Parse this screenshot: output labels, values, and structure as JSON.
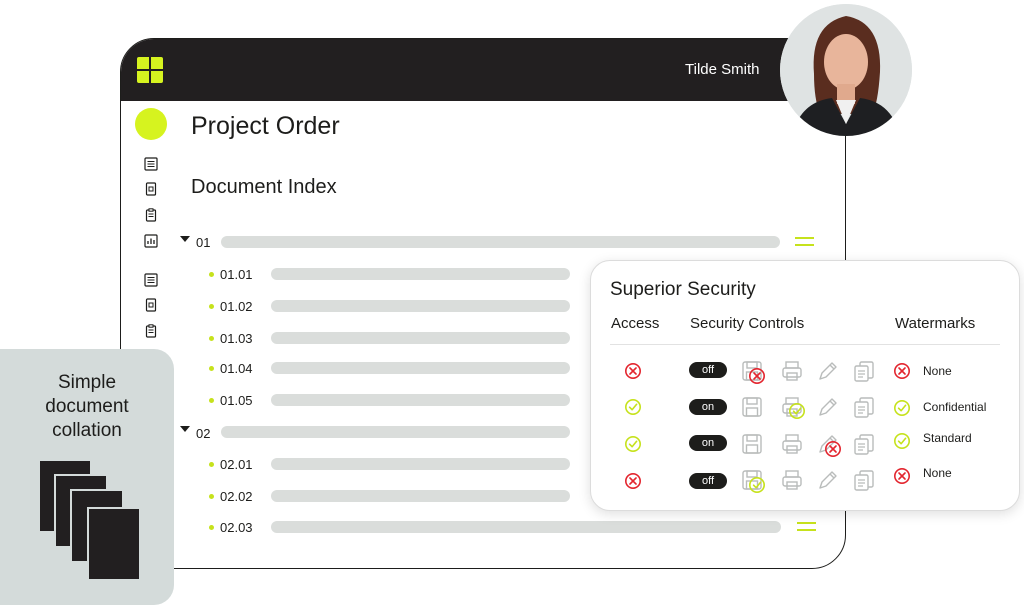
{
  "header": {
    "user_name": "Tilde Smith"
  },
  "page": {
    "title": "Project Order",
    "subtitle": "Document Index"
  },
  "index": {
    "sections": [
      {
        "label": "01",
        "items": [
          "01.01",
          "01.02",
          "01.03",
          "01.04",
          "01.05"
        ]
      },
      {
        "label": "02",
        "items": [
          "02.01",
          "02.02",
          "02.03"
        ]
      }
    ]
  },
  "security": {
    "title": "Superior Security",
    "columns": {
      "access": "Access",
      "controls": "Security Controls",
      "watermarks": "Watermarks"
    },
    "rows": [
      {
        "access": "denied",
        "toggle": "off",
        "watermark": "None",
        "watermark_status": "denied"
      },
      {
        "access": "granted",
        "toggle": "on",
        "watermark": "Confidential",
        "watermark_status": "granted"
      },
      {
        "access": "granted",
        "toggle": "on",
        "watermark": "Standard",
        "watermark_status": "granted"
      },
      {
        "access": "denied",
        "toggle": "off",
        "watermark": "None",
        "watermark_status": "denied"
      }
    ]
  },
  "collation": {
    "line1": "Simple",
    "line2": "document",
    "line3": "collation"
  },
  "colors": {
    "accent": "#d6f31f",
    "dark": "#221f20",
    "denied": "#e3262f",
    "granted": "#c6e21c",
    "panel": "#d4dbda"
  }
}
